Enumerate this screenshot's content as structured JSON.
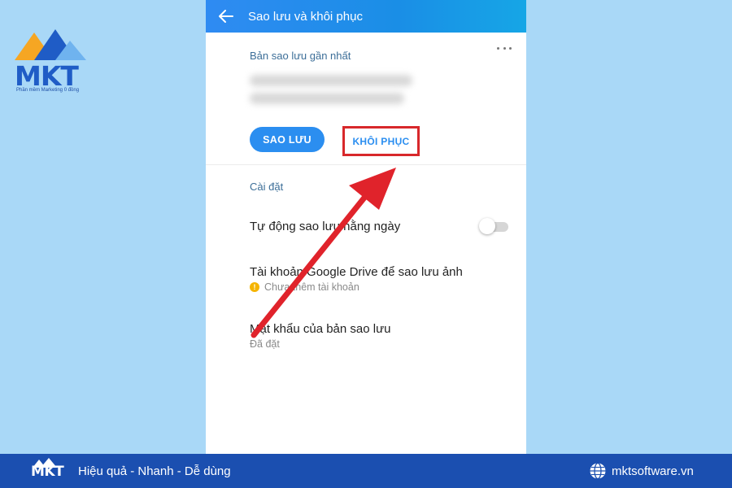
{
  "logo": {
    "text": "MKT",
    "tagline": "Phần mềm Marketing 0 đồng"
  },
  "appbar": {
    "back_icon": "arrow-left-icon",
    "title": "Sao lưu và khôi phục"
  },
  "latest_backup": {
    "label": "Bản sao lưu gần nhất",
    "more_icon": "more-horizontal-icon"
  },
  "buttons": {
    "backup": "SAO LƯU",
    "restore": "KHÔI PHỤC"
  },
  "settings": {
    "label": "Cài đặt",
    "auto_backup": {
      "title": "Tự động sao lưu hằng ngày",
      "enabled": false
    },
    "drive_account": {
      "title": "Tài khoản Google Drive để sao lưu ảnh",
      "status": "Chưa thêm tài khoản",
      "status_icon": "warning-icon"
    },
    "backup_password": {
      "title": "Mật khẩu của bản sao lưu",
      "status": "Đã đặt"
    }
  },
  "footer": {
    "logo_text": "MKT",
    "tagline": "Hiệu quả - Nhanh - Dễ dùng",
    "website": "mktsoftware.vn",
    "website_icon": "globe-icon"
  },
  "colors": {
    "background": "#a9d8f7",
    "appbar": "#2f8bf2",
    "primary_button": "#2b8ef0",
    "highlight_box": "#d8282b",
    "arrow": "#e0232b",
    "footer": "#1b4fb0"
  }
}
